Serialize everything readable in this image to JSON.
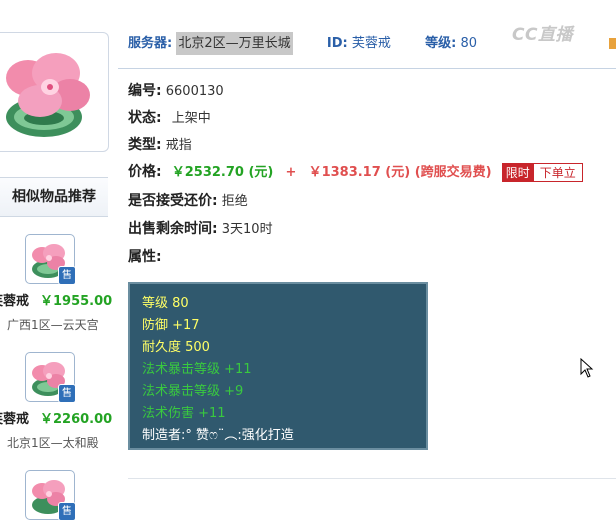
{
  "header": {
    "server_label": "服务器:",
    "server_value": "北京2区—万里长城",
    "id_label": "ID:",
    "id_value": "芙蓉戒",
    "level_label": "等级:",
    "level_value": "80",
    "watermark": "CC直播"
  },
  "item": {
    "number_label": "编号:",
    "number_value": "6600130",
    "status_label": "状态:",
    "status_value": "上架中",
    "type_label": "类型:",
    "type_value": "戒指",
    "price_label": "价格:",
    "price_main": "￥2532.70 (元)",
    "price_plus": "+",
    "price_fee": "￥1383.17 (元) (跨服交易费)",
    "limit_badge": "限时",
    "order_button": "下单立",
    "bargain_label": "是否接受还价:",
    "bargain_value": "拒绝",
    "remaining_label": "出售剩余时间:",
    "remaining_value": "3天10时",
    "attr_label": "属性:"
  },
  "attributes": {
    "a1": "等级 80",
    "a2": "防御 +17",
    "a3": "耐久度 500",
    "a4": "法术暴击等级 +11",
    "a5": "法术暴击等级 +9",
    "a6": "法术伤害 +11",
    "a7": "制造者:° 赞ෆ¨︵:强化打造"
  },
  "similar": {
    "header": "相似物品推荐",
    "sold_badge": "售",
    "items": [
      {
        "name": "芙蓉戒",
        "price": "￥1955.00",
        "server": "广西1区—云天宫"
      },
      {
        "name": "芙蓉戒",
        "price": "￥2260.00",
        "server": "北京1区—太和殿"
      }
    ]
  },
  "colors": {
    "label_blue": "#2a5fa8",
    "price_green": "#23a323",
    "fee_red": "#e04f4f",
    "panel_bg": "#30596e"
  },
  "icons": [
    "jade-flower-ring-icon",
    "sold-badge-icon",
    "cursor-arrow-icon"
  ]
}
